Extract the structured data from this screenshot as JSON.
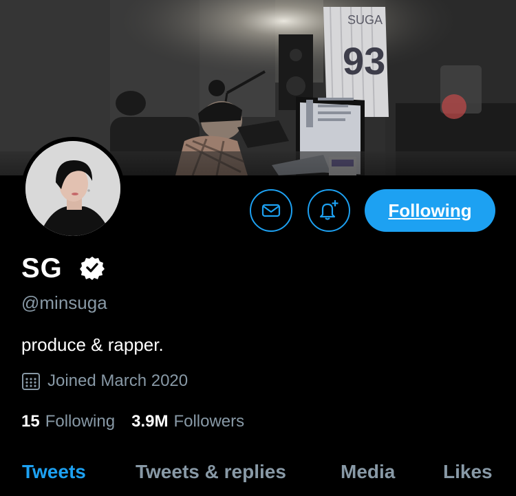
{
  "profile": {
    "display_name": "SG",
    "handle": "@minsuga",
    "bio": "produce & rapper.",
    "joined": "Joined March 2020",
    "verified": true
  },
  "actions": {
    "message_icon": "envelope-icon",
    "notify_icon": "bell-plus-icon",
    "follow_label": "Following"
  },
  "stats": {
    "following_count": "15",
    "following_label": "Following",
    "followers_count": "3.9M",
    "followers_label": "Followers"
  },
  "tabs": [
    {
      "label": "Tweets",
      "active": true
    },
    {
      "label": "Tweets & replies",
      "active": false
    },
    {
      "label": "Media",
      "active": false
    },
    {
      "label": "Likes",
      "active": false
    }
  ],
  "banner": {
    "jersey_name": "SUGA",
    "jersey_number": "93"
  },
  "colors": {
    "accent": "#1da1f2",
    "muted_text": "#8899a6",
    "background": "#000000"
  }
}
